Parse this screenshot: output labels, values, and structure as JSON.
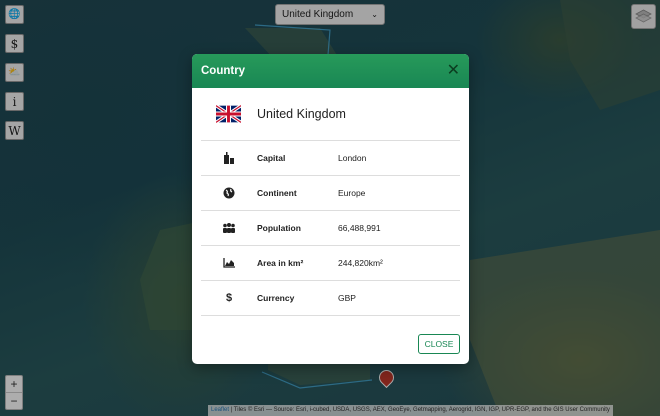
{
  "country_select": {
    "value": "United Kingdom"
  },
  "sidebar": {
    "buttons": [
      {
        "name": "globe-icon",
        "glyph": "🌐"
      },
      {
        "name": "currency-icon",
        "glyph": "$"
      },
      {
        "name": "weather-icon",
        "glyph": "⛅"
      },
      {
        "name": "info-icon",
        "glyph": "i"
      },
      {
        "name": "wikipedia-icon",
        "glyph": "W"
      }
    ]
  },
  "zoom": {
    "in": "+",
    "out": "−"
  },
  "attribution": {
    "leaflet": "Leaflet",
    "text": " | Tiles © Esri — Source: Esri, i-cubed, USDA, USGS, AEX, GeoEye, Getmapping, Aerogrid, IGN, IGP, UPR-EGP, and the GIS User Community"
  },
  "modal": {
    "title": "Country",
    "close_icon": "✕",
    "country_name": "United Kingdom",
    "rows": [
      {
        "icon": "capital-icon",
        "label": "Capital",
        "value": "London"
      },
      {
        "icon": "continent-icon",
        "label": "Continent",
        "value": "Europe"
      },
      {
        "icon": "population-icon",
        "label": "Population",
        "value": "66,488,991"
      },
      {
        "icon": "area-icon",
        "label": "Area in km²",
        "value": "244,820km²"
      },
      {
        "icon": "currency-icon",
        "label": "Currency",
        "value": "GBP"
      }
    ],
    "close_button": "CLOSE"
  },
  "colors": {
    "accent": "#198754"
  }
}
